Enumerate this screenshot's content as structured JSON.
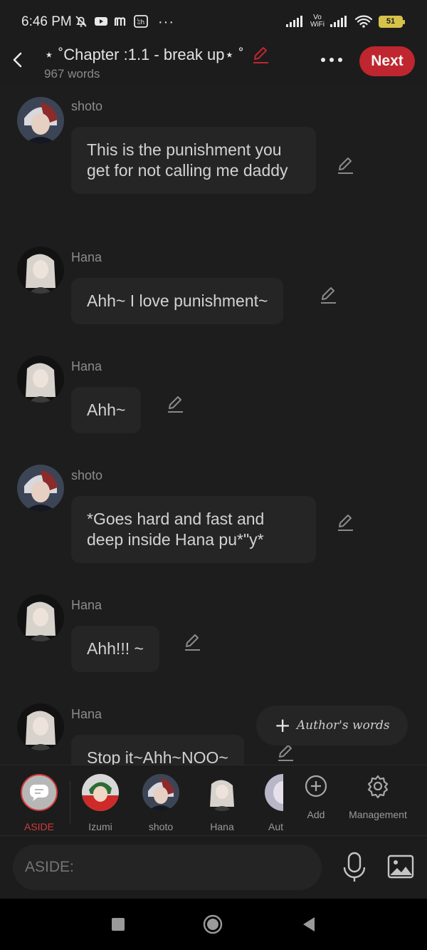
{
  "status_bar": {
    "time": "6:46 PM",
    "vowifi_top": "Vo",
    "vowifi_bottom": "WiFi",
    "battery": "51",
    "more": "···"
  },
  "header": {
    "title": "⋆ ˚Chapter :1.1 - break up⋆ ˚",
    "word_count": "967 words",
    "next_label": "Next",
    "accent_color": "#c0262f"
  },
  "messages": [
    {
      "speaker": "shoto",
      "text": "This is the punishment you get for not calling me daddy",
      "avatar": "shoto-avatar"
    },
    {
      "speaker": "Hana",
      "text": "Ahh~ I love punishment~",
      "avatar": "hana-avatar"
    },
    {
      "speaker": "Hana",
      "text": "Ahh~",
      "avatar": "hana-avatar"
    },
    {
      "speaker": "shoto",
      "text": "*Goes hard and fast and deep inside Hana pu*\"y*",
      "avatar": "shoto-avatar"
    },
    {
      "speaker": "Hana",
      "text": "Ahh!!! ~",
      "avatar": "hana-avatar"
    },
    {
      "speaker": "Hana",
      "text": "Stop it~Ahh~NOO~",
      "avatar": "hana-avatar"
    }
  ],
  "authors_words": {
    "label": "Author's words"
  },
  "characters": [
    {
      "label": "ASIDE",
      "active": true
    },
    {
      "label": "Izumi"
    },
    {
      "label": "shoto"
    },
    {
      "label": "Hana"
    },
    {
      "label": "Aut"
    }
  ],
  "tools": {
    "add_label": "Add",
    "management_label": "Management"
  },
  "input": {
    "placeholder": "ASIDE:"
  }
}
